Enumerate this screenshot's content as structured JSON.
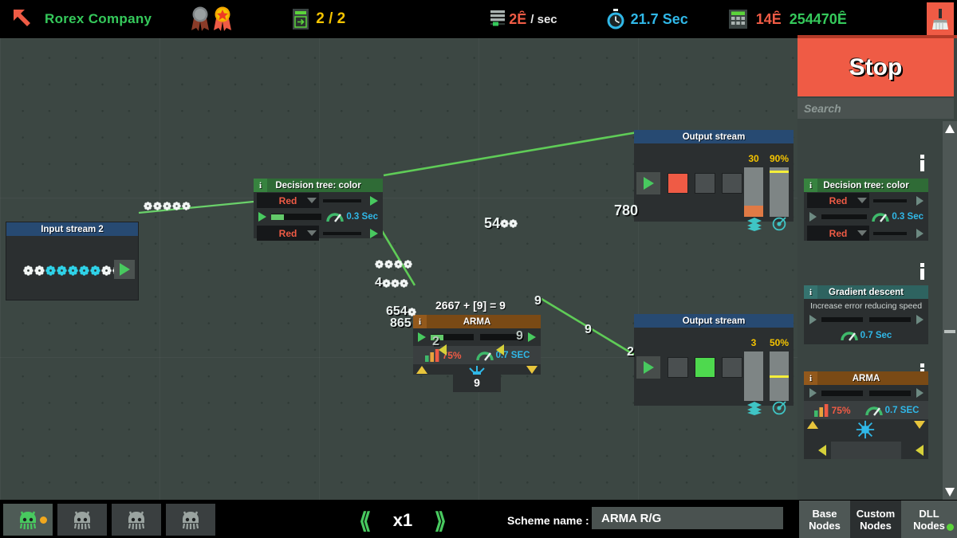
{
  "topbar": {
    "logo_icon": "arrow-up-left-icon",
    "company_name": "Rorex Company",
    "medals": [
      {
        "name": "medal-locked",
        "color": "#8a8d8e",
        "earned": false
      },
      {
        "name": "medal-gold-star",
        "color": "#f5c400",
        "earned": true
      }
    ],
    "level": {
      "icon": "level-box-icon",
      "value": "2 / 2"
    },
    "rate": {
      "icon": "stack-rate-icon",
      "value": "2",
      "currency": "Ȇ",
      "unit": "/ sec"
    },
    "timer": {
      "icon": "stopwatch-icon",
      "value": "21.7 Sec"
    },
    "money": {
      "icon": "calculator-icon",
      "cost": "14Ȇ",
      "balance": "254470Ȇ"
    },
    "clean_button": {
      "icon": "broom-icon",
      "color": "#ef5b45"
    }
  },
  "canvas": {
    "nodes": [
      {
        "id": "input-stream-2",
        "title": "Input stream 2",
        "title_color": "#274a72",
        "info_icon": "info-icon",
        "stream_gears": [
          "white",
          "white",
          "cyan",
          "cyan",
          "cyan",
          "cyan",
          "cyan",
          "white",
          "white"
        ],
        "play_icon": "play-icon"
      },
      {
        "id": "decision-tree-color",
        "title": "Decision tree: color",
        "title_color": "#2f6b36",
        "info_icon": "info-icon",
        "input_dropdown": "Red",
        "output_dropdown": "Red",
        "speed": "0.3 Sec",
        "speed_icon": "gauge-icon",
        "slider_fill_pct": 22
      },
      {
        "id": "arma-node",
        "title": "ARMA",
        "title_color": "#7a4a15",
        "info_icon": "info-icon",
        "formula": "2667 + [9] = 9",
        "quality": "75%",
        "quality_icon": "bar-chart-icon",
        "speed": "0.7 SEC",
        "speed_icon": "gauge-icon",
        "core_icon": "neural-net-icon",
        "foot_value": "9",
        "slider_fill_pct": 28
      },
      {
        "id": "output-stream-1",
        "title": "Output stream",
        "title_color": "#274a72",
        "play_icon": "play-icon",
        "swatches": [
          "#ef5b45",
          "#4a4f50",
          "#4a4f50"
        ],
        "stack_count": "30",
        "stack_icon": "layers-icon",
        "accuracy": "90%",
        "accuracy_icon": "target-icon",
        "stack_fill_pct": 22,
        "stack_fill_color": "#e07a45",
        "accuracy_marker_pct": 90
      },
      {
        "id": "output-stream-2",
        "title": "Output stream",
        "title_color": "#274a72",
        "play_icon": "play-icon",
        "swatches": [
          "#4a4f50",
          "#4ed94e",
          "#4a4f50"
        ],
        "stack_count": "3",
        "stack_icon": "layers-icon",
        "accuracy": "50%",
        "accuracy_icon": "target-icon",
        "stack_fill_pct": 0,
        "accuracy_marker_pct": 50
      }
    ],
    "wire_labels": [
      {
        "id": "wl-54",
        "value": "54",
        "gears": 2
      },
      {
        "id": "wl-780",
        "value": "780"
      },
      {
        "id": "wl-4",
        "value": "4",
        "gears": 3
      },
      {
        "id": "wl-654",
        "value": "654",
        "gears": 1
      },
      {
        "id": "wl-865",
        "value": "865"
      },
      {
        "id": "wl-9-out",
        "value": "9"
      },
      {
        "id": "wl-9-mid",
        "value": "9"
      },
      {
        "id": "wl-2-in",
        "value": "2"
      },
      {
        "id": "wl-2-arma",
        "value": "2"
      },
      {
        "id": "wl-9-arma",
        "value": "9"
      }
    ]
  },
  "sidebar": {
    "stop_label": "Stop",
    "search_placeholder": "Search",
    "palette_items": [
      {
        "id": "pal-decision-tree",
        "title": "Decision tree: color",
        "title_color": "#2f6b36",
        "info_icon": "info-icon",
        "input_dropdown": "Red",
        "output_dropdown": "Red",
        "speed": "0.3 Sec",
        "speed_icon": "gauge-icon"
      },
      {
        "id": "pal-gradient-descent",
        "title": "Gradient descent",
        "title_color": "#2e6360",
        "info_icon": "info-icon",
        "subtitle": "Increase error reducing speed",
        "speed": "0.7 Sec",
        "speed_icon": "gauge-icon"
      },
      {
        "id": "pal-arma",
        "title": "ARMA",
        "title_color": "#7a4a15",
        "info_icon": "info-icon",
        "quality": "75%",
        "quality_icon": "bar-chart-icon",
        "speed": "0.7 SEC",
        "speed_icon": "gauge-icon",
        "core_icon": "neural-net-icon"
      }
    ],
    "scrollbar": {
      "up_icon": "triangle-up-icon",
      "down_icon": "triangle-down-icon"
    }
  },
  "bottombar": {
    "scheme_tabs": [
      {
        "id": "scheme-tab-1",
        "icon": "octopus-icon",
        "active": true,
        "color": "#48c95f",
        "has_dot": true
      },
      {
        "id": "scheme-tab-2",
        "icon": "octopus-icon",
        "active": false,
        "color": "#9aa3a0",
        "has_dot": false
      },
      {
        "id": "scheme-tab-3",
        "icon": "octopus-icon",
        "active": false,
        "color": "#9aa3a0",
        "has_dot": false
      },
      {
        "id": "scheme-tab-4",
        "icon": "octopus-icon",
        "active": false,
        "color": "#9aa3a0",
        "has_dot": false
      }
    ],
    "speed": {
      "prev_icon": "chevron-left-icon",
      "value": "x1",
      "next_icon": "chevron-right-icon"
    },
    "scheme_name_label": "Scheme name :",
    "scheme_name_value": "ARMA R/G",
    "node_tabs": [
      {
        "id": "tab-base-nodes",
        "line1": "Base",
        "line2": "Nodes",
        "selected": false
      },
      {
        "id": "tab-custom-nodes",
        "line1": "Custom",
        "line2": "Nodes",
        "selected": true
      },
      {
        "id": "tab-dll-nodes",
        "line1": "DLL",
        "line2": "Nodes",
        "selected": false,
        "has_dot": true
      }
    ]
  },
  "colors": {
    "accent_red": "#ef5b45",
    "accent_green": "#48c95f",
    "accent_blue": "#30b8e8",
    "accent_yellow": "#f5c400",
    "canvas_bg": "#3c4743"
  }
}
